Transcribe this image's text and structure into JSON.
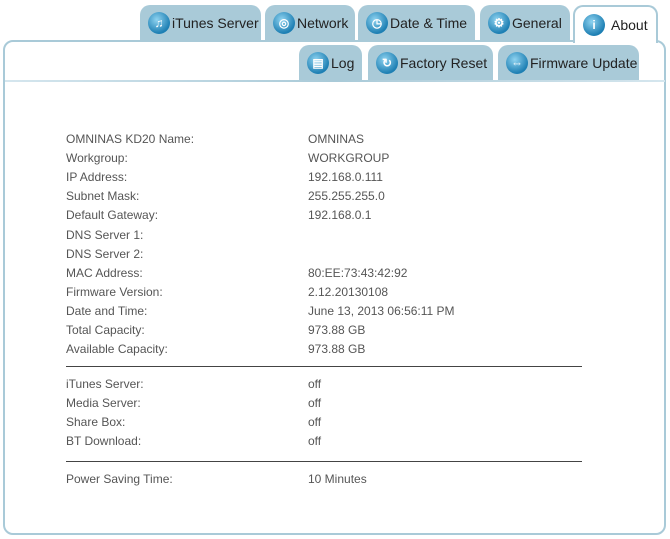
{
  "tabs": [
    {
      "label": "iTunes Server",
      "icon": "music-note-icon"
    },
    {
      "label": "Network",
      "icon": "network-globe-icon"
    },
    {
      "label": "Date & Time",
      "icon": "clock-icon"
    },
    {
      "label": "General",
      "icon": "gears-icon"
    },
    {
      "label": "About",
      "icon": "info-icon",
      "active": true
    }
  ],
  "subtabs": [
    {
      "label": "Log",
      "icon": "log-book-icon"
    },
    {
      "label": "Factory Reset",
      "icon": "reset-arrow-icon"
    },
    {
      "label": "Firmware Update",
      "icon": "firmware-update-icon"
    }
  ],
  "info": [
    {
      "label": "OMNINAS KD20 Name:",
      "value": "OMNINAS"
    },
    {
      "label": "Workgroup:",
      "value": "WORKGROUP"
    },
    {
      "label": "IP Address:",
      "value": "192.168.0.111"
    },
    {
      "label": "Subnet Mask:",
      "value": "255.255.255.0"
    },
    {
      "label": "Default Gateway:",
      "value": "192.168.0.1"
    },
    {
      "label": "DNS Server 1:",
      "value": ""
    },
    {
      "label": "DNS Server 2:",
      "value": ""
    },
    {
      "label": "MAC Address:",
      "value": "80:EE:73:43:42:92"
    },
    {
      "label": "Firmware Version:",
      "value": "2.12.20130108"
    },
    {
      "label": "Date and Time:",
      "value": "June 13, 2013 06:56:11 PM"
    },
    {
      "label": "Total Capacity:",
      "value": "973.88 GB"
    },
    {
      "label": "Available Capacity:",
      "value": "973.88 GB"
    }
  ],
  "services": [
    {
      "label": "iTunes Server:",
      "value": "off"
    },
    {
      "label": "Media Server:",
      "value": "off"
    },
    {
      "label": "Share Box:",
      "value": "off"
    },
    {
      "label": "BT Download:",
      "value": "off"
    }
  ],
  "power": [
    {
      "label": "Power Saving Time:",
      "value": "10 Minutes"
    }
  ]
}
